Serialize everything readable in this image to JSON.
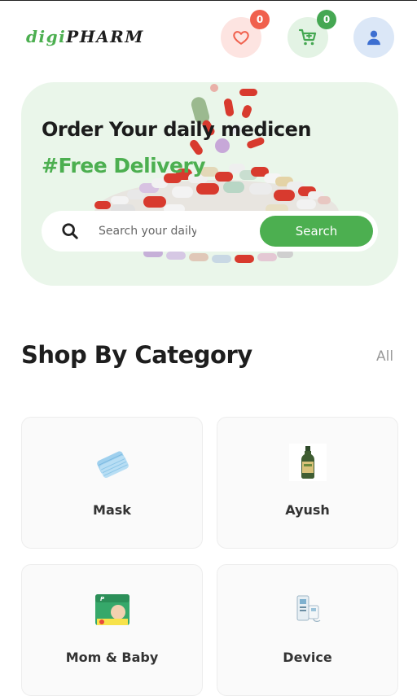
{
  "header": {
    "logo_part1": "digi",
    "logo_part2": "PHARM",
    "wishlist_count": "0",
    "cart_count": "0",
    "icons": {
      "wishlist": "heart-icon",
      "cart": "cart-plus-icon",
      "user": "user-icon"
    }
  },
  "hero": {
    "title": "Order Your daily medicen",
    "subtitle": "#Free Delivery",
    "search_placeholder": "Search your daily medicine",
    "search_button": "Search"
  },
  "category_section": {
    "title": "Shop By Category",
    "all_link": "All",
    "items": [
      {
        "label": "Mask",
        "icon": "mask-icon"
      },
      {
        "label": "Ayush",
        "icon": "ayush-bottle-icon"
      },
      {
        "label": "Mom & Baby",
        "icon": "diaper-pack-icon"
      },
      {
        "label": "Device",
        "icon": "device-icon"
      }
    ]
  },
  "colors": {
    "brand_green": "#4caf50",
    "wishlist_badge": "#f0604d",
    "cart_badge": "#45a752",
    "hero_bg": "#eaf6ea"
  }
}
